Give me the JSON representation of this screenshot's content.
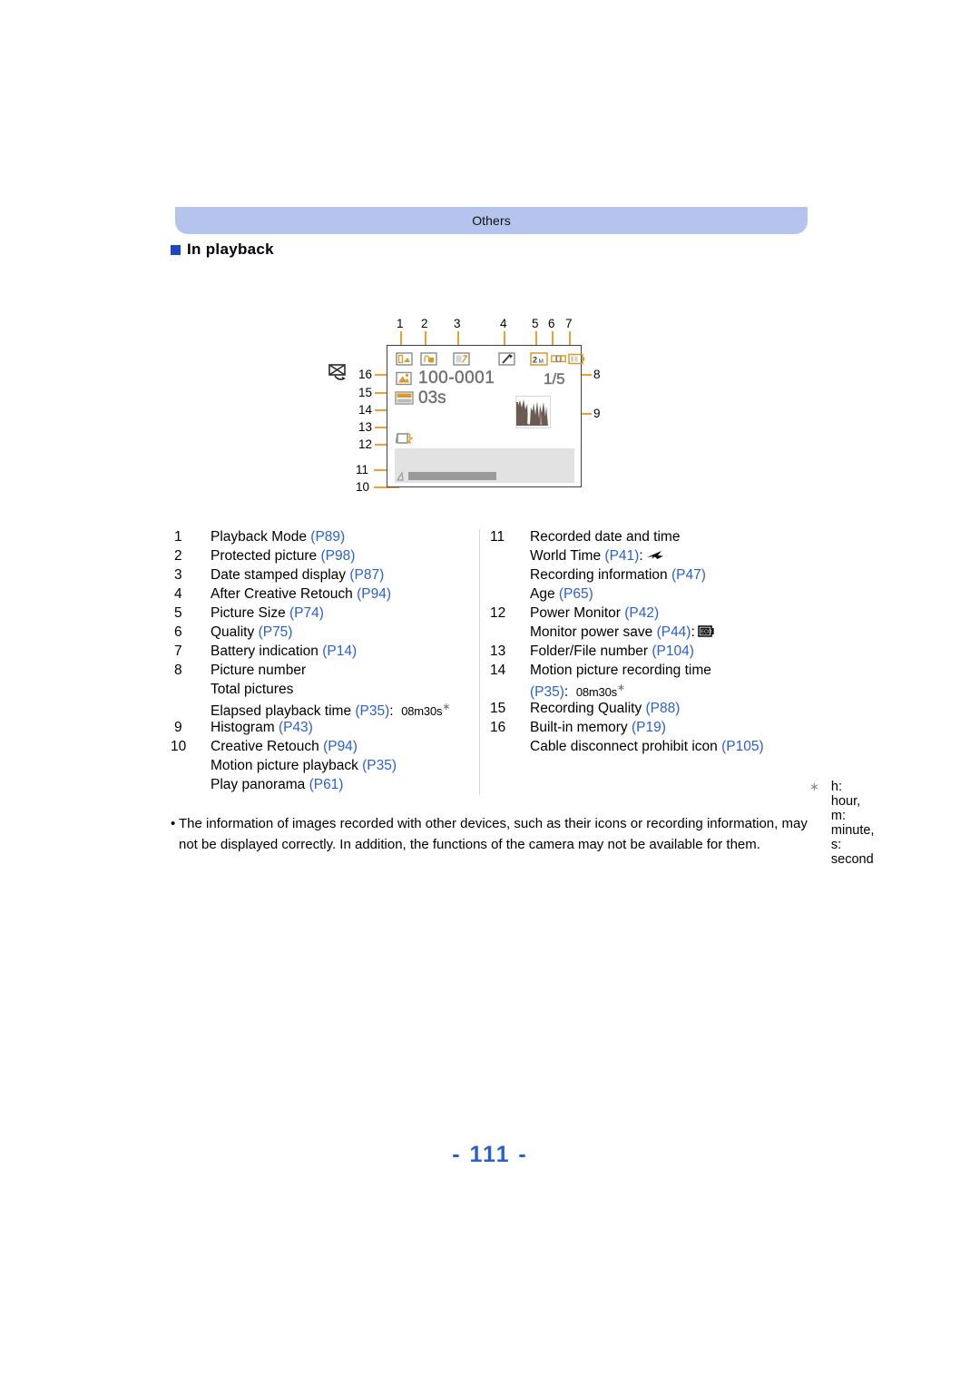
{
  "header": {
    "title": "Others"
  },
  "section": {
    "heading": "In playback",
    "bullet_color": "#1b49c4"
  },
  "diagram": {
    "callout_numbers": [
      "1",
      "2",
      "3",
      "4",
      "5",
      "6",
      "7",
      "8",
      "9",
      "10",
      "11",
      "12",
      "13",
      "14",
      "15",
      "16"
    ],
    "screen": {
      "folder_file_number": "100-0001",
      "elapsed_time": "03s",
      "picture_number": "1/5",
      "icons": [
        "playback-mode-icon",
        "protected-picture-icon",
        "date-stamped-display-icon",
        "after-creative-retouch-icon",
        "picture-size-2m-icon",
        "quality-icon",
        "battery-indication-icon",
        "built-in-memory-icon",
        "recording-quality-icon",
        "power-monitor-icon",
        "histogram-icon",
        "creative-retouch-arrow-icon",
        "cable-disconnect-prohibit-icon"
      ],
      "picture_size_label": "2ₘ"
    }
  },
  "legend": {
    "left": [
      {
        "index": "1",
        "lines": [
          {
            "text": "Playback Mode ",
            "ref": "(P89)"
          }
        ]
      },
      {
        "index": "2",
        "lines": [
          {
            "text": "Protected picture ",
            "ref": "(P98)"
          }
        ]
      },
      {
        "index": "3",
        "lines": [
          {
            "text": "Date stamped display ",
            "ref": "(P87)"
          }
        ]
      },
      {
        "index": "4",
        "lines": [
          {
            "text": "After Creative Retouch ",
            "ref": "(P94)"
          }
        ]
      },
      {
        "index": "5",
        "lines": [
          {
            "text": "Picture Size ",
            "ref": "(P74)"
          }
        ]
      },
      {
        "index": "6",
        "lines": [
          {
            "text": "Quality ",
            "ref": "(P75)"
          }
        ]
      },
      {
        "index": "7",
        "lines": [
          {
            "text": "Battery indication ",
            "ref": "(P14)"
          }
        ]
      },
      {
        "index": "8",
        "lines": [
          {
            "text": "Picture number",
            "ref": ""
          }
        ]
      },
      {
        "index": "",
        "lines": [
          {
            "text": "Total pictures",
            "ref": ""
          }
        ]
      },
      {
        "index": "",
        "lines": [
          {
            "text": "Elapsed playback time ",
            "ref": "(P35)",
            "suffix": ":",
            "value": "08m30s",
            "asterisk": "∗"
          }
        ]
      },
      {
        "index": "9",
        "lines": [
          {
            "text": "Histogram ",
            "ref": "(P43)"
          }
        ]
      },
      {
        "index": "10",
        "lines": [
          {
            "text": "Creative Retouch ",
            "ref": "(P94)"
          }
        ]
      },
      {
        "index": "",
        "lines": [
          {
            "text": "Motion picture playback ",
            "ref": "(P35)"
          }
        ]
      },
      {
        "index": "",
        "lines": [
          {
            "text": "Play panorama ",
            "ref": "(P61)"
          }
        ]
      }
    ],
    "right": [
      {
        "index": "11",
        "lines": [
          {
            "text": "Recorded date and time",
            "ref": ""
          }
        ]
      },
      {
        "index": "",
        "lines": [
          {
            "text": "World Time ",
            "ref": "(P41)",
            "suffix": ":",
            "icon": "airplane-icon"
          }
        ]
      },
      {
        "index": "",
        "lines": [
          {
            "text": "Recording information ",
            "ref": "(P47)"
          }
        ]
      },
      {
        "index": "",
        "lines": [
          {
            "text": "Age ",
            "ref": "(P65)"
          }
        ]
      },
      {
        "index": "12",
        "lines": [
          {
            "text": "Power Monitor ",
            "ref": "(P42)"
          }
        ]
      },
      {
        "index": "",
        "lines": [
          {
            "text": "Monitor power save ",
            "ref": "(P44)",
            "suffix": ":",
            "icon": "eco-monitor-icon"
          }
        ]
      },
      {
        "index": "13",
        "lines": [
          {
            "text": "Folder/File number ",
            "ref": "(P104)"
          }
        ]
      },
      {
        "index": "14",
        "lines": [
          {
            "text": "Motion picture recording time",
            "ref": ""
          }
        ]
      },
      {
        "index": "",
        "lines": [
          {
            "text": "",
            "ref": "(P35)",
            "suffix": ":",
            "value": "08m30s",
            "asterisk": "∗"
          }
        ]
      },
      {
        "index": "15",
        "lines": [
          {
            "text": "Recording Quality ",
            "ref": "(P88)"
          }
        ]
      },
      {
        "index": "16",
        "lines": [
          {
            "text": "Built-in memory ",
            "ref": "(P19)"
          }
        ]
      },
      {
        "index": "",
        "lines": [
          {
            "text": "Cable disconnect prohibit icon ",
            "ref": "(P105)"
          }
        ]
      }
    ],
    "footnote": {
      "symbol": "∗",
      "text": "h: hour, m: minute, s: second"
    }
  },
  "note": {
    "bullet": "•",
    "text": "The information of images recorded with other devices, such as their icons or recording information, may not be displayed correctly. In addition, the functions of the camera may not be available for them."
  },
  "page": {
    "number": "- 111 -"
  },
  "colors": {
    "header_bar": "#b4c4ec",
    "reference_link": "#2a5fd0",
    "callout_leader": "#f0a030",
    "lcd_glyph": "#6f6f6f",
    "section_bullet": "#1b49c4"
  }
}
